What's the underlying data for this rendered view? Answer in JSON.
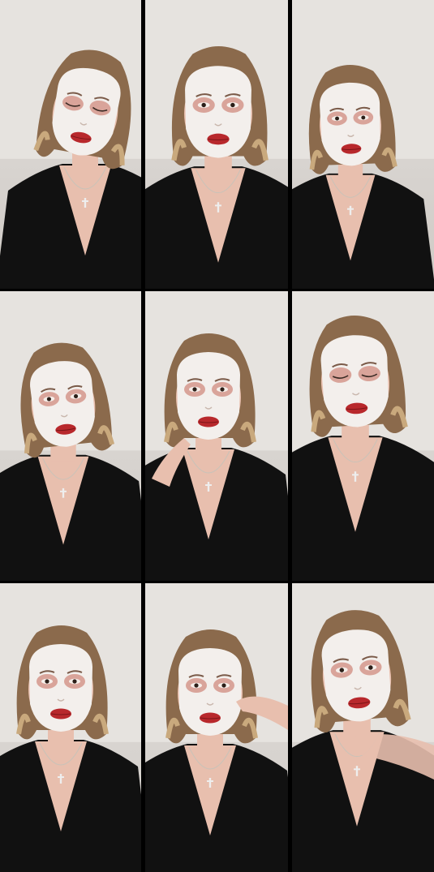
{
  "grid": {
    "rows": 3,
    "cols": 3
  },
  "tiles": [
    {
      "id": 1,
      "pose": "eyes-closed-head-tilt",
      "hand": false
    },
    {
      "id": 2,
      "pose": "frontal-neutral",
      "hand": false
    },
    {
      "id": 3,
      "pose": "frontal-hair-moving",
      "hand": false
    },
    {
      "id": 4,
      "pose": "head-tilt-left",
      "hand": false
    },
    {
      "id": 5,
      "pose": "finger-on-chin",
      "hand": true
    },
    {
      "id": 6,
      "pose": "eyes-closed-hair-moving",
      "hand": false
    },
    {
      "id": 7,
      "pose": "frontal-neutral",
      "hand": false
    },
    {
      "id": 8,
      "pose": "hand-touching-face",
      "hand": true
    },
    {
      "id": 9,
      "pose": "arm-raised-blur",
      "hand": true
    }
  ],
  "colors": {
    "background": "#dcd8d4",
    "shirt": "#111111",
    "skin": "#e8bfae",
    "mask": "#f3efec",
    "hair": "#8b6a4c",
    "lips": "#b8282c"
  }
}
